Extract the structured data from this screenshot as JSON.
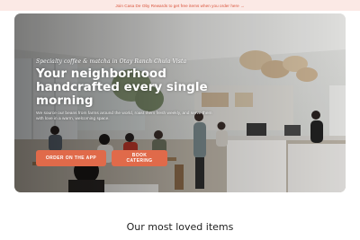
{
  "promo": {
    "text": "Join Casa De Oby Rewards to get free items when you order here →"
  },
  "hero": {
    "tagline": "Specialty coffee & matcha in Otay Ranch Chula Vista",
    "headline": "Your neighborhood handcrafted every single morning",
    "subtext": "We source our beans from farms around the world, roast them fresh weekly, and serve them with love in a warm, welcoming space.",
    "buttons": {
      "order": "ORDER ON THE APP",
      "catering": "BOOK CATERING"
    }
  },
  "section": {
    "title": "Our most loved items"
  },
  "colors": {
    "accent": "#e06a4a",
    "promo_bg": "#fbe9e5",
    "promo_text": "#d9533a"
  }
}
